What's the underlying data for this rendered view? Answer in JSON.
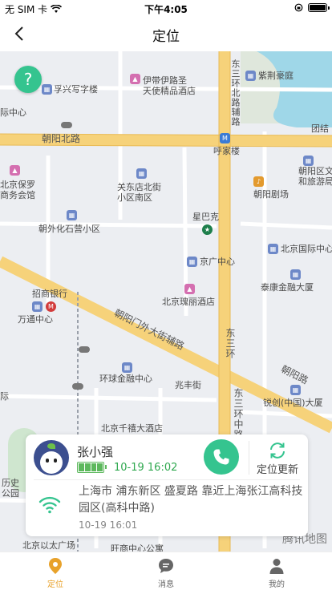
{
  "status_bar": {
    "carrier": "无 SIM 卡",
    "time": "下午4:05"
  },
  "nav": {
    "title": "定位"
  },
  "map": {
    "labels": {
      "fuxing": "孚兴写字楼",
      "ibis": "伊带伊路圣\n天使精品酒店",
      "ziyuan": "紫荆豪庭",
      "zhongxin": "际中心",
      "chaoyang_north_road": "朝阳北路",
      "huanbei": "东三环北路辅路",
      "hujialou": "呼家楼",
      "tuanjie": "团结",
      "baoluo": "北京保罗\n商务会馆",
      "guandong": "关东店北街\n小区南区",
      "chaoyangqu": "朝阳区文\n和旅游局",
      "theatre": "朝阳剧场",
      "shiying": "朝外化石营小区",
      "starbucks": "星巴克",
      "guoji": "北京国际中心",
      "jingguang": "京广中心",
      "zhaoshang": "招商银行",
      "wantong": "万通中心",
      "kunlun": "北京瑰丽酒店",
      "taikang": "泰康金融大厦",
      "chaoyangmen": "朝阳门外大街辅路",
      "dongsanhuan": "东三环",
      "chaoyang_road": "朝阳路",
      "huanqiu": "环球金融中心",
      "zhaofeng": "兆丰街",
      "ruineng": "锐创(中国)大厦",
      "fuzhu": "辅路",
      "guoji2": "际",
      "dongsanhuan_zhong": "东三环中路",
      "qianxi": "北京千禧大酒店",
      "lishi": "历史\n公园",
      "yitai": "北京以太广场",
      "wangshang": "旺商中心公寓"
    },
    "watermark": "腾讯地图",
    "help_glyph": "?"
  },
  "card": {
    "name": "张小强",
    "battery_time": "10-19 16:02",
    "refresh_label": "定位更新",
    "address": "上海市 浦东新区 盛夏路 靠近上海张江高科技园区(高科中路)",
    "address_time": "10-19 16:01"
  },
  "tabs": [
    {
      "label": "定位",
      "icon": "location-pin-icon",
      "active": true
    },
    {
      "label": "消息",
      "icon": "message-icon",
      "active": false
    },
    {
      "label": "我的",
      "icon": "person-icon",
      "active": false
    }
  ],
  "colors": {
    "accent_green": "#35c48f",
    "tab_active": "#e8a22b",
    "road_yellow": "#f6d27a"
  }
}
